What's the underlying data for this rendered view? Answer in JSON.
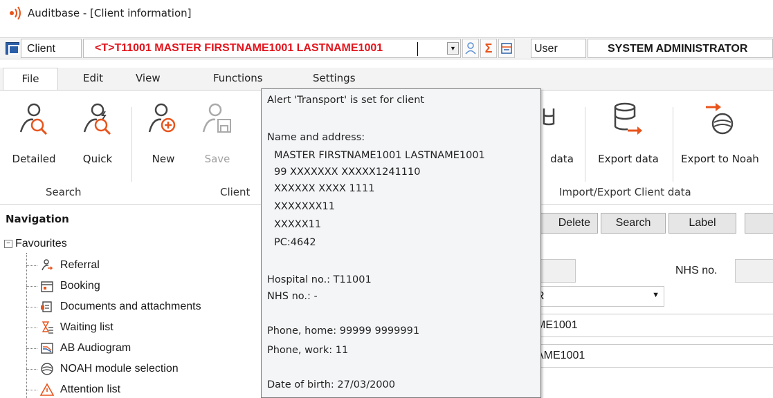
{
  "window": {
    "title": "Auditbase - [Client information]"
  },
  "clientbar": {
    "client_label": "Client",
    "client_value": "<T>T11001 MASTER FIRSTNAME1001 LASTNAME1001",
    "user_label": "User",
    "user_value": "SYSTEM ADMINISTRATOR"
  },
  "menu": {
    "items": [
      "File",
      "Edit",
      "View",
      "Functions",
      "Settings"
    ]
  },
  "ribbon": {
    "buttons": {
      "detailed": "Detailed",
      "quick": "Quick",
      "new": "New",
      "save": "Save",
      "import_data": "data",
      "export_data": "Export data",
      "export_noah": "Export to Noah"
    },
    "groups": {
      "search": "Search",
      "client": "Client",
      "import_export": "Import/Export Client data"
    }
  },
  "navigation": {
    "title": "Navigation",
    "root": "Favourites",
    "items": [
      "Referral",
      "Booking",
      "Documents and attachments",
      "Waiting list",
      "AB Audiogram",
      "NOAH module selection",
      "Attention list"
    ]
  },
  "form": {
    "buttons": {
      "delete": "Delete",
      "search": "Search",
      "label": "Label"
    },
    "nhs_label": "NHS no.",
    "fields": [
      "R",
      "ME1001",
      "AME1001"
    ]
  },
  "tooltip": {
    "alert": "Alert 'Transport' is set for client",
    "address_header": "Name and address:",
    "address_lines": [
      "MASTER FIRSTNAME1001 LASTNAME1001",
      "99 XXXXXXX XXXXX1241110",
      "XXXXXX XXXX 1111",
      "XXXXXXX11",
      "XXXXX11",
      "PC:4642"
    ],
    "hospital_no": "Hospital no.: T11001",
    "nhs_no": "NHS no.: -",
    "phone_home": "Phone, home: 99999 9999991",
    "phone_work": "Phone, work: 11",
    "dob": "Date of birth: 27/03/2000"
  },
  "colors": {
    "client_text": "#e2141c",
    "accent_orange": "#e8541c",
    "icon_gray": "#444444"
  }
}
